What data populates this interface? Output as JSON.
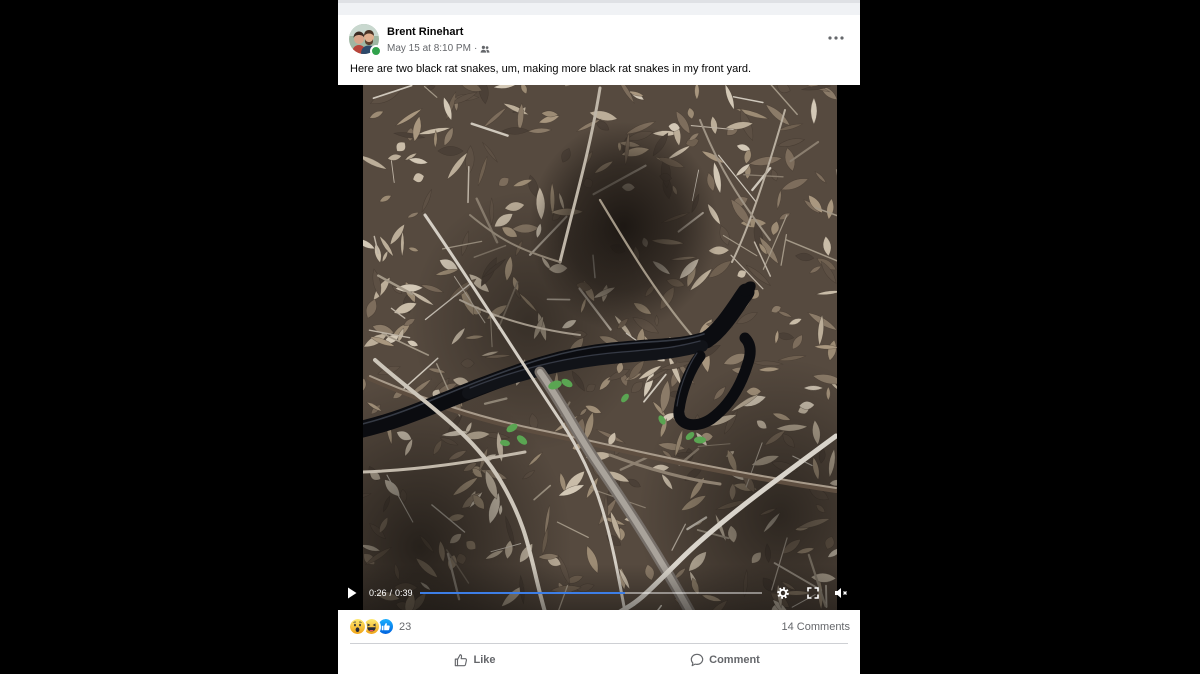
{
  "post": {
    "author": "Brent Rinehart",
    "timestamp": "May 15 at 8:10 PM",
    "meta_separator": "·",
    "audience_icon": "friends-icon",
    "more_icon": "more-options-icon",
    "author_online": true,
    "text": "Here are two black rat snakes, um, making more black rat snakes in my front yard."
  },
  "video": {
    "current_time": "0:26",
    "time_separator": "/",
    "duration": "0:39",
    "played_fraction": 0.6,
    "play_state_icon": "play-icon",
    "control_icons": [
      "settings-gear-icon",
      "fullscreen-icon",
      "volume-muted-icon"
    ]
  },
  "reactions": {
    "icons": [
      "wow-reaction-icon",
      "haha-reaction-icon",
      "like-reaction-icon"
    ],
    "count": "23"
  },
  "comments": {
    "count_label": "14 Comments"
  },
  "actions": [
    {
      "label": "Like",
      "icon": "like-icon"
    },
    {
      "label": "Comment",
      "icon": "comment-icon"
    }
  ],
  "colors": {
    "accent": "#1877f2",
    "progress": "#3d7ee6",
    "online": "#31a24c",
    "primary_text": "#050505",
    "secondary_text": "#65676b",
    "page_background": "#000000"
  }
}
